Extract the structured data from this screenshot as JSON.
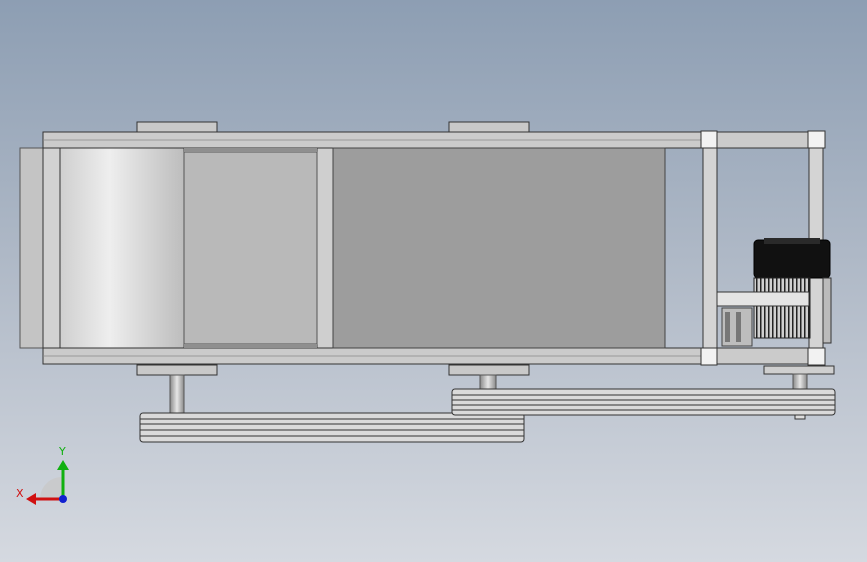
{
  "viewport": {
    "background_top": "#8d9eb3",
    "background_bottom": "#d5d9e0"
  },
  "colors": {
    "frame": "#c9cacc",
    "frame_edge": "#3a3a3a",
    "roller": "#e0e0e0",
    "panel": "#9c9c9c",
    "belt": "#d8d8d8",
    "motor": "#111111"
  },
  "triad": {
    "x_label": "X",
    "y_label": "Y",
    "x_color": "#d01010",
    "y_color": "#10b010",
    "z_color": "#1020d0"
  }
}
